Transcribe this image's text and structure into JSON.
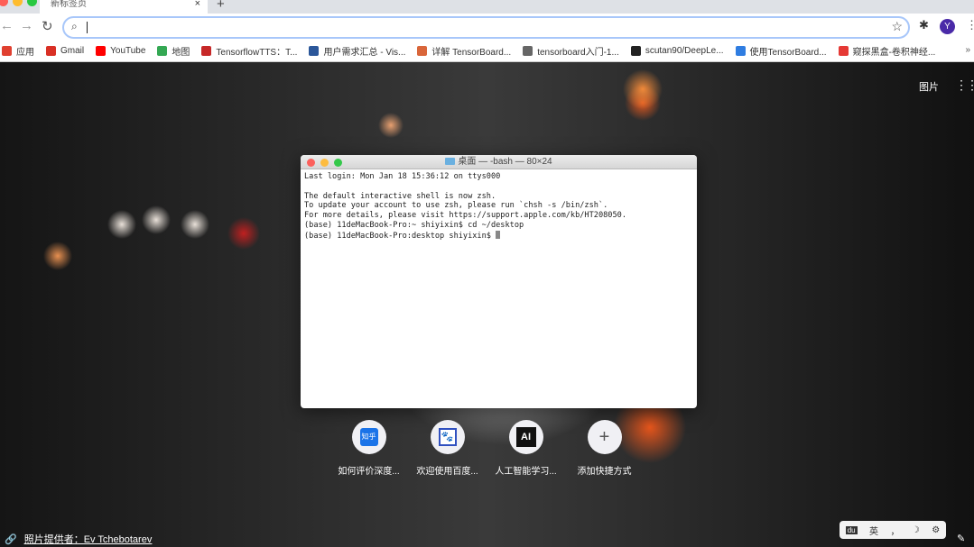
{
  "tab": {
    "title": "新标签页",
    "close": "×",
    "new_tab": "+"
  },
  "toolbar": {
    "back": "←",
    "forward": "→",
    "reload": "↻",
    "search_icon": "search-icon",
    "address": "",
    "star": "☆",
    "extensions": "✱",
    "avatar": "Y",
    "menu": "⋮"
  },
  "bookmarks": [
    {
      "label": "应用",
      "color": "#e04030"
    },
    {
      "label": "Gmail",
      "color": "#d93025"
    },
    {
      "label": "YouTube",
      "color": "#ff0000"
    },
    {
      "label": "地图",
      "color": "#34a853"
    },
    {
      "label": "TensorflowTTS：T...",
      "color": "#c62828"
    },
    {
      "label": "用户需求汇总 - Vis...",
      "color": "#2b579a"
    },
    {
      "label": "详解 TensorBoard...",
      "color": "#d9663a"
    },
    {
      "label": "tensorboard入门-1...",
      "color": "#666666"
    },
    {
      "label": "scutan90/DeepLe...",
      "color": "#222222"
    },
    {
      "label": "使用TensorBoard...",
      "color": "#2f7de1"
    },
    {
      "label": "窥探黑盒-卷积神经...",
      "color": "#e53935"
    }
  ],
  "bookmarks_more": "»",
  "ntp": {
    "photos": "图片",
    "apps": "⋮⋮⋮",
    "credit_prefix": "照片提供者：",
    "credit_name": "Ev Tchebotarev"
  },
  "terminal": {
    "title": "桌面 — -bash — 80×24",
    "lines": [
      "Last login: Mon Jan 18 15:36:12 on ttys000",
      "",
      "The default interactive shell is now zsh.",
      "To update your account to use zsh, please run `chsh -s /bin/zsh`.",
      "For more details, please visit https://support.apple.com/kb/HT208050.",
      "(base) 11deMacBook-Pro:~ shiyixin$ cd ~/desktop",
      "(base) 11deMacBook-Pro:desktop shiyixin$ "
    ]
  },
  "shortcuts": [
    {
      "label": "如何评价深度...",
      "icon": "知乎"
    },
    {
      "label": "欢迎使用百度...",
      "icon": "🐾"
    },
    {
      "label": "人工智能学习...",
      "icon": "AI"
    },
    {
      "label": "添加快捷方式",
      "icon": "+"
    }
  ],
  "ime": {
    "logo": "du",
    "lang": "英",
    "punct": "，",
    "moon": "☽",
    "gear": "⚙"
  },
  "pen": "✎"
}
